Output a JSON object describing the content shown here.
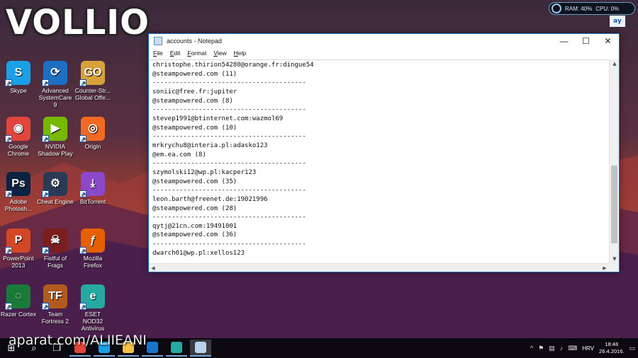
{
  "watermark": {
    "logo": "VOLLIO",
    "footer": "aparat.com/ALIIEANI"
  },
  "sysmon": {
    "ram": "RAM: 40%",
    "cpu": "CPU: 0%"
  },
  "desktop": {
    "icons": [
      {
        "label": "Skype",
        "color": "#1aa0e6",
        "glyph": "S"
      },
      {
        "label": "Advanced SystemCare 9",
        "color": "#1d6fc4",
        "glyph": "⟳"
      },
      {
        "label": "Counter-Str... Global Offe...",
        "color": "#d7a23a",
        "glyph": "GO"
      },
      {
        "label": "Google Chrome",
        "color": "#e2453c",
        "glyph": "◉"
      },
      {
        "label": "NVIDIA Shadow Play",
        "color": "#76b900",
        "glyph": "▶"
      },
      {
        "label": "Origin",
        "color": "#f26a22",
        "glyph": "◎"
      },
      {
        "label": "Adobe Photosh...",
        "color": "#0b2340",
        "glyph": "Ps"
      },
      {
        "label": "Cheat Engine",
        "color": "#2a3a55",
        "glyph": "⚙"
      },
      {
        "label": "BitTorrent",
        "color": "#8b48c8",
        "glyph": "⤓"
      },
      {
        "label": "PowerPoint 2013",
        "color": "#d24726",
        "glyph": "P"
      },
      {
        "label": "Fistful of Frags",
        "color": "#7a1e1e",
        "glyph": "☠"
      },
      {
        "label": "Mozilla Firefox",
        "color": "#e66000",
        "glyph": "ƒ"
      },
      {
        "label": "Razer Cortex",
        "color": "#1a7a3a",
        "glyph": "◌"
      },
      {
        "label": "Team Fortress 2",
        "color": "#b35a1f",
        "glyph": "TF"
      },
      {
        "label": "ESET NOD32 Antivirus",
        "color": "#25a9a0",
        "glyph": "e"
      }
    ],
    "partial_icon_glyph": "ay"
  },
  "notepad": {
    "title": "accounts - Notepad",
    "menu": [
      "File",
      "Edit",
      "Format",
      "View",
      "Help"
    ],
    "window_buttons": {
      "minimize": "—",
      "maximize": "☐",
      "close": "✕"
    },
    "lines": [
      "christophe.thirion54280@orange.fr:dingue54",
      "@steampowered.com (11)",
      "----------------------------------------",
      "soniic@free.fr:jupiter",
      "@steampowered.com (8)",
      "----------------------------------------",
      "stevep1991@btinternet.com:wazmol69",
      "@steampowered.com (10)",
      "----------------------------------------",
      "mrkrychu8@interia.pl:adasko123",
      "@em.ea.com (8)",
      "----------------------------------------",
      "szymolski12@wp.pl:kacper123",
      "@steampowered.com (35)",
      "----------------------------------------",
      "leon.barth@freenet.de:19021996",
      "@steampowered.com (28)",
      "----------------------------------------",
      "qytj@21cn.com:19491001",
      "@steampowered.com (36)",
      "----------------------------------------",
      "dwarch01@wp.pl:xellos123"
    ]
  },
  "taskbar": {
    "apps": [
      {
        "name": "chrome",
        "color": "#e2453c"
      },
      {
        "name": "skype",
        "color": "#1aa0e6"
      },
      {
        "name": "explorer",
        "color": "#f3c144"
      },
      {
        "name": "store",
        "color": "#1a74c9"
      },
      {
        "name": "eset",
        "color": "#25a9a0"
      },
      {
        "name": "notepad",
        "color": "#b9d3ea"
      }
    ],
    "language": "HRV",
    "time": "18:48",
    "date": "26.4.2016."
  }
}
